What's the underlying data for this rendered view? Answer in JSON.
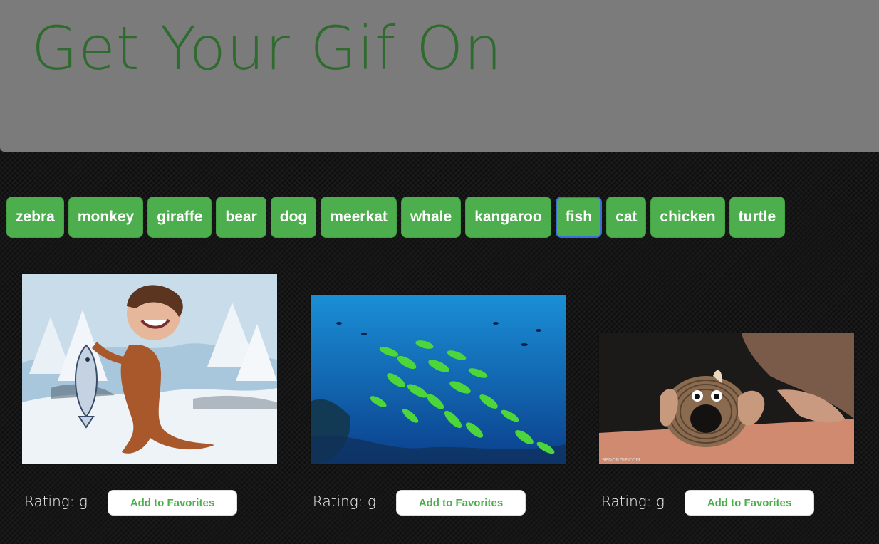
{
  "header": {
    "title": "Get Your Gif On"
  },
  "topics": [
    {
      "label": "zebra",
      "active": false
    },
    {
      "label": "monkey",
      "active": false
    },
    {
      "label": "giraffe",
      "active": false
    },
    {
      "label": "bear",
      "active": false
    },
    {
      "label": "dog",
      "active": false
    },
    {
      "label": "meerkat",
      "active": false
    },
    {
      "label": "whale",
      "active": false
    },
    {
      "label": "kangaroo",
      "active": false
    },
    {
      "label": "fish",
      "active": true
    },
    {
      "label": "cat",
      "active": false
    },
    {
      "label": "chicken",
      "active": false
    },
    {
      "label": "turtle",
      "active": false
    }
  ],
  "gifs": [
    {
      "rating_label": "Rating: g",
      "favorite_label": "Add to Favorites"
    },
    {
      "rating_label": "Rating: g",
      "favorite_label": "Add to Favorites"
    },
    {
      "rating_label": "Rating: g",
      "favorite_label": "Add to Favorites",
      "watermark": "SENORGIF.COM"
    }
  ],
  "colors": {
    "accent_green": "#4cae4c",
    "title_green": "#2f6b2f",
    "header_gray": "#7b7b7b",
    "active_outline": "#3a6fd6"
  }
}
